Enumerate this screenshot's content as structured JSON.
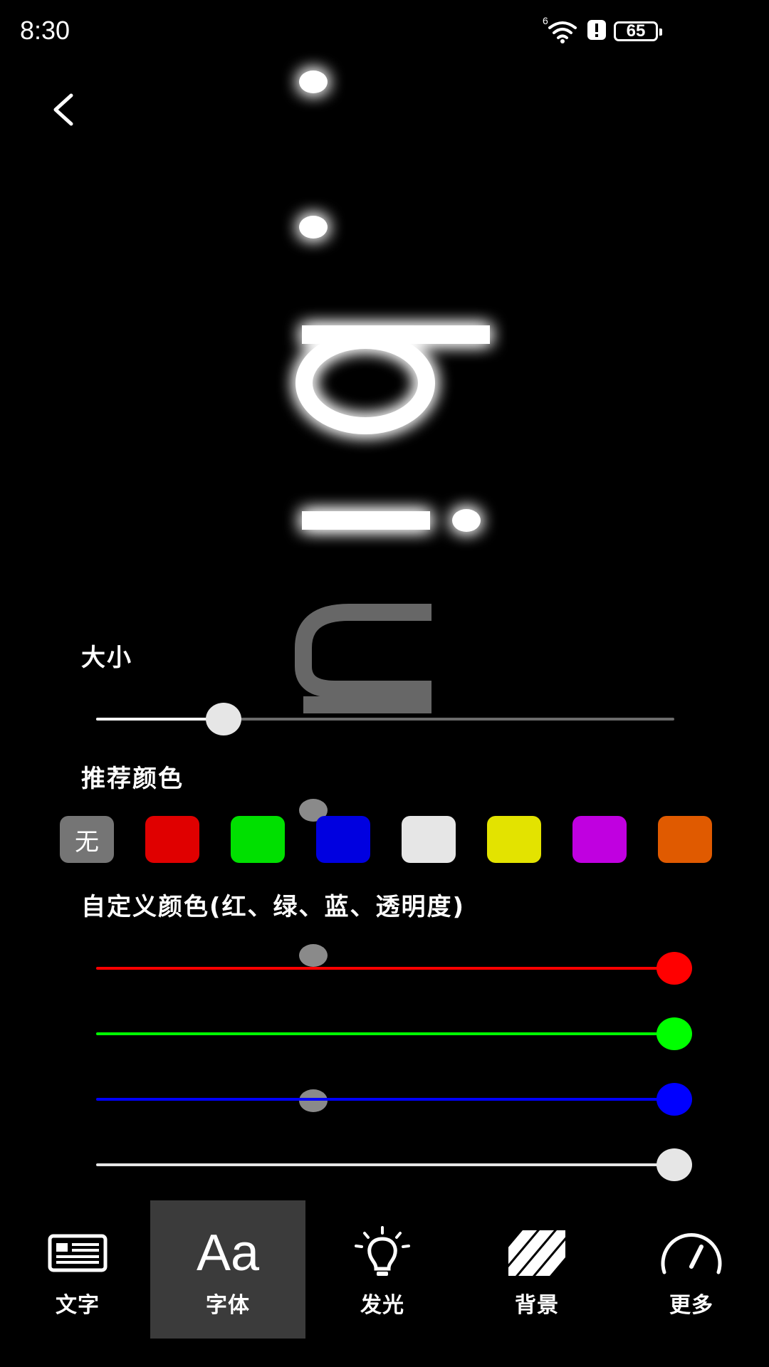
{
  "status_bar": {
    "time": "8:30",
    "network_badge": "6",
    "battery": "65",
    "icons": [
      "wifi-icon",
      "alert-icon",
      "battery-icon"
    ]
  },
  "back": {
    "icon": "chevron-left-icon"
  },
  "preview": {
    "text": "hi :",
    "glow_color": "#ffffff"
  },
  "size_section": {
    "label": "大小",
    "value": 0.22
  },
  "recommended_colors": {
    "label": "推荐颜色",
    "none_label": "无",
    "swatches": [
      "#e00000",
      "#00e000",
      "#0000e0",
      "#e6e6e6",
      "#e3e300",
      "#c000e0",
      "#e05a00"
    ],
    "none_color": "#757575"
  },
  "custom_color": {
    "label": "自定义颜色(红、绿、蓝、透明度)",
    "channels": [
      {
        "name": "红",
        "color": "#ff0000",
        "value": 1.0
      },
      {
        "name": "绿",
        "color": "#00ff00",
        "value": 1.0
      },
      {
        "name": "蓝",
        "color": "#0000ff",
        "value": 1.0
      },
      {
        "name": "透明度",
        "color": "#e6e6e6",
        "value": 1.0
      }
    ]
  },
  "bottom_nav": {
    "items": [
      {
        "label": "文字",
        "icon": "text-card-icon"
      },
      {
        "label": "字体",
        "icon": "font-aa-icon",
        "active": true,
        "glyph": "Aa"
      },
      {
        "label": "发光",
        "icon": "lightbulb-icon"
      },
      {
        "label": "背景",
        "icon": "stripes-icon"
      },
      {
        "label": "更多",
        "icon": "speedometer-icon"
      }
    ]
  }
}
